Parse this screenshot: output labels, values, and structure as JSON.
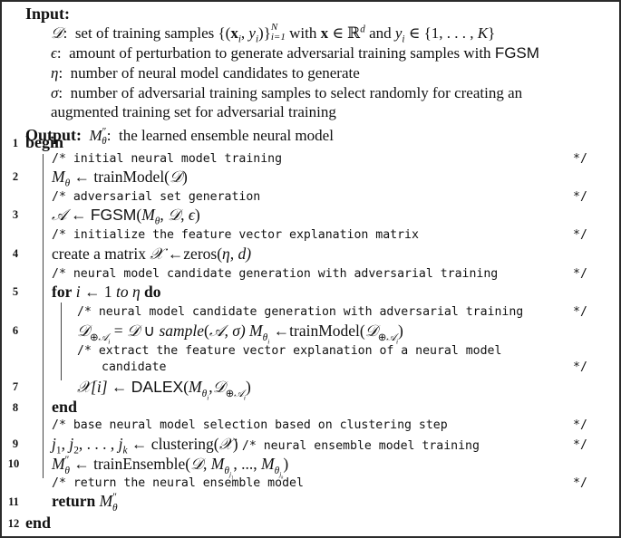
{
  "header": {
    "input_label": "Input:",
    "inputs": [
      {
        "symbol": "𝒟:",
        "text": "set of training samples {(x",
        "rest": "with x ∈ ℝ",
        "tail": "and y",
        "tail2": "∈ {1, . . . , K}",
        "full": "𝒟: set of training samples {(x_i, y_i)}_{i=1}^{N} with x ∈ ℝ^d and y_i ∈ {1, . . . , K}"
      },
      {
        "symbol": "ϵ:",
        "text": "amount of perturbation to generate adversarial training samples with",
        "method": "FGSM"
      },
      {
        "symbol": "η:",
        "text": "number of neural model candidates to generate"
      },
      {
        "symbol": "σ:",
        "text": "number of adversarial training samples to select randomly for creating an",
        "continuation": "augmented training set for adversarial training"
      }
    ],
    "output_label": "Output:",
    "output_symbol": "M″θ:",
    "output_text": "the learned ensemble neural model"
  },
  "lines": [
    {
      "num": "1",
      "keyword": "begin"
    },
    {
      "comment": "/* initial neural model training",
      "end": "*/"
    },
    {
      "num": "2",
      "code": "M",
      "full": "Mθ ← trainModel(𝒟)"
    },
    {
      "comment": "/* adversarial set generation",
      "end": "*/"
    },
    {
      "num": "3",
      "full": "𝒜 ← FGSM(Mθ, 𝒟, ϵ)"
    },
    {
      "comment": "/* initialize the feature vector explanation matrix",
      "end": "*/"
    },
    {
      "num": "4",
      "full": "create a matrix 𝒳 ←zeros(η, d)"
    },
    {
      "comment": "/* neural model candidate generation with adversarial training",
      "end": "*/"
    },
    {
      "num": "5",
      "kw_for": "for",
      "loop": "i ← 1",
      "to": "to",
      "eta": "η",
      "kw_do": "do"
    },
    {
      "comment": "/* neural model candidate generation with adversarial training",
      "end": "*/"
    },
    {
      "num": "6",
      "full": "𝒟⊕𝒜i = 𝒟 ∪ sample(𝒜, σ) Mθi ←trainModel(𝒟⊕𝒜i)"
    },
    {
      "comment": "/* extract the feature vector explanation of a neural model",
      "comment_cont": "candidate",
      "end": "*/"
    },
    {
      "num": "7",
      "full": "𝒳[i] ← DALEX(Mθi,𝒟⊕𝒜i)"
    },
    {
      "num": "8",
      "keyword": "end"
    },
    {
      "comment": "/* base neural model selection based on clustering step",
      "end": "*/"
    },
    {
      "num": "9",
      "full": "j1, j2, . . . , jk ← clustering(𝒳)",
      "inline_comment": "/* neural ensemble model training",
      "end": "*/"
    },
    {
      "num": "10",
      "full": "M″θ ← trainEnsemble(𝒟, Mθj1, ..., Mθjk)"
    },
    {
      "comment": "/* return the neural ensemble model",
      "end": "*/"
    },
    {
      "num": "11",
      "keyword": "return",
      "full": "M″θ"
    },
    {
      "num": "12",
      "keyword": "end"
    }
  ],
  "t": {
    "input": "Input:",
    "output": "Output:",
    "D": "𝒟",
    "A": "𝒜",
    "X": "𝒳",
    "eps": "ϵ",
    "eta": "η",
    "sigma": "σ",
    "colon": ":",
    "in1a": "set of training samples {(",
    "x": "x",
    "i": "i",
    "comma": ", ",
    "y": "y",
    "close": ")}",
    "N": "N",
    "ieq1": "i=1",
    "in1b": " with ",
    "in1c": " ∈ ℝ",
    "d": "d",
    "in1d": " and ",
    "in1e": " ∈ {1, . . . , ",
    "K": "K",
    "brace": "}",
    "in2": "amount of perturbation to generate adversarial training samples with ",
    "fgsm": "FGSM",
    "in3": "number of neural model candidates to generate",
    "in4": "number of adversarial training samples to select randomly for creating an",
    "in4b": "augmented training set for adversarial training",
    "M": "M",
    "theta": "θ",
    "dprime": "″",
    "out_text": "the learned ensemble neural model",
    "begin": "begin",
    "end": "end",
    "cend": "*/",
    "c1": "/* initial neural model training",
    "c2": "/* adversarial set generation",
    "c3": "/* initialize the feature vector explanation matrix",
    "c4": "/* neural model candidate generation with adversarial training",
    "c5": "/* neural model candidate generation with adversarial training",
    "c6": "/* extract the feature vector explanation of a neural model",
    "c6b": "candidate",
    "c7": "/* base neural model selection based on clustering step",
    "c8": "/* neural ensemble model training",
    "c9": "/* return the neural ensemble model",
    "larr": " ← ",
    "larr2": " ←",
    "trainModel": "trainModel(",
    "rparen": ")",
    "fgsm_open": "(",
    "create": "create a matrix ",
    "zeros": "zeros(",
    "comma_d": ", d)",
    "for": "for",
    "one": " 1 ",
    "to": "to",
    "do": "do",
    "oplus": "⊕",
    "eqD": " = ",
    "cup": " ∪ ",
    "sample": "sample",
    "sigma_close": ", σ) ",
    "bracket_i": "[i]",
    "dalex": "DALEX",
    "j1": "j",
    "s1": "1",
    "s2": "2",
    "k": "k",
    "dots": ", . . . , ",
    "clustering": "clustering(",
    "trainEnsemble": "trainEnsemble(",
    "dots3": ", ..., ",
    "return": "return",
    "n": [
      "1",
      "2",
      "3",
      "4",
      "5",
      "6",
      "7",
      "8",
      "9",
      "10",
      "11",
      "12"
    ]
  }
}
